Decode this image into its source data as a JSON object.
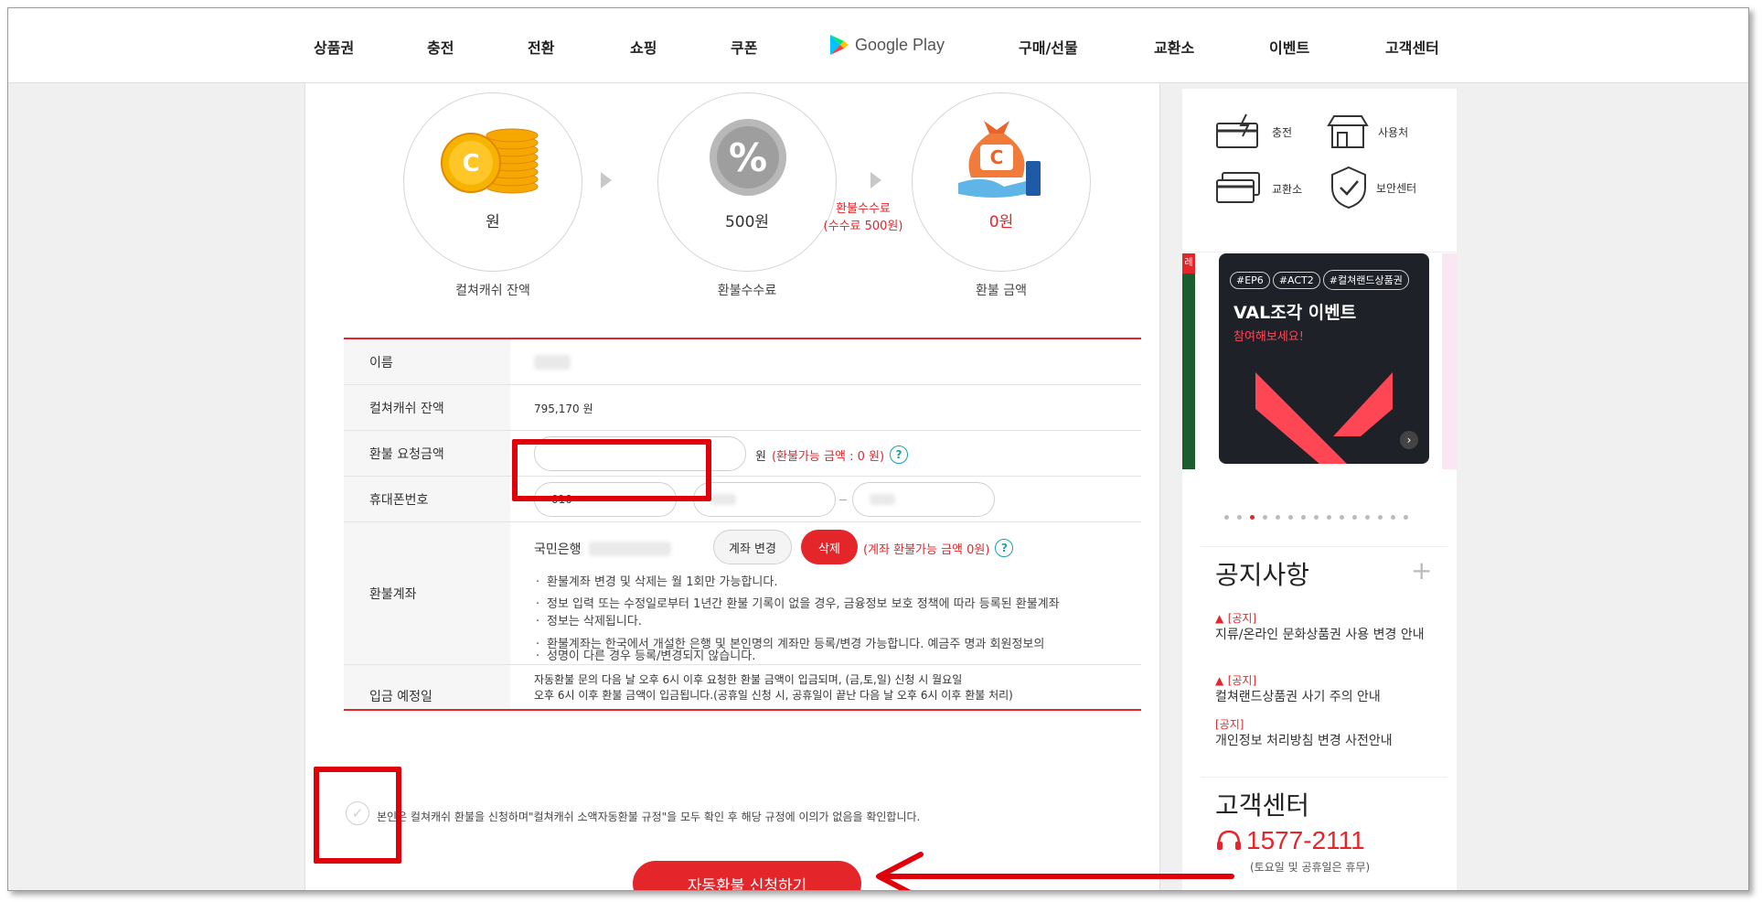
{
  "nav": {
    "items": [
      "상품권",
      "충전",
      "전환",
      "쇼핑",
      "쿠폰"
    ],
    "google_play": "Google Play",
    "items_right": [
      "구매/선물",
      "교환소",
      "이벤트",
      "고객센터"
    ]
  },
  "summary": {
    "balance_amount": "원",
    "balance_caption": "컬쳐캐쉬 잔액",
    "fee_amount": "500원",
    "fee_caption": "환불수수료",
    "fee_note_line1": "환불수수료",
    "fee_note_line2": "(수수료 500원)",
    "refund_amount": "0원",
    "refund_caption": "환불 금액"
  },
  "form": {
    "name_label": "이름",
    "balance_label": "컬쳐캐쉬 잔액",
    "balance_value": "795,170 원",
    "request_label": "환불 요청금액",
    "request_unit": "원",
    "request_note": "(환불가능 금액 : 0 원)",
    "phone_label": "휴대폰번호",
    "phone_first": "010",
    "account_label": "환불계좌",
    "bank_name": "국민은행",
    "change_button": "계좌 변경",
    "delete_button": "삭제",
    "account_note": "(계좌 환불가능 금액 0원)",
    "help_icon": "?",
    "bullets": [
      "환불계좌 변경 및 삭제는 월 1회만 가능합니다.",
      "정보 입력 또는 수정일로부터 1년간 환불 기록이 없을 경우, 금융정보 보호 정책에 따라 등록된 환불계좌",
      "정보는 삭제됩니다.",
      "환불계좌는 한국에서 개설한 은행 및 본인명의 계좌만 등록/변경 가능합니다. 예금주 명과 회원정보의",
      "성명이 다른 경우 등록/변경되지 않습니다."
    ],
    "deposit_label": "입금 예정일",
    "deposit_line1": "자동환불 문의 다음 날 오후 6시 이후 요청한 환불 금액이 입금되며, (금,토,일) 신청 시 월요일",
    "deposit_line2": "오후 6시 이후 환불 금액이 입금됩니다.(공휴일 신청 시, 공휴일이 끝난 다음 날 오후 6시 이후 환불 처리)"
  },
  "agree_text": "본인은 컬쳐캐쉬 환불을 신청하며\"컬쳐캐쉬 소액자동환불 규정\"을 모두 확인 후 해당 규정에 이의가 없음을 확인합니다.",
  "submit_label": "자동환불 신청하기",
  "side": {
    "quick": [
      "충전",
      "사용처",
      "교환소",
      "보안센터"
    ],
    "banner_tags": [
      "#EP6",
      "#ACT2",
      "#컬쳐랜드상품권"
    ],
    "banner_title": "VAL조각 이벤트",
    "banner_sub": "참여해보세요!",
    "notice_title": "공지사항",
    "notice_plus": "+",
    "notices": [
      {
        "tag": "[공지]",
        "text": "지류/온라인 문화상품권 사용 변경 안내"
      },
      {
        "tag": "[공지]",
        "text": "컬쳐랜드상품권 사기 주의 안내"
      },
      {
        "tag": "[공지]",
        "text": "개인정보 처리방침 변경 사전안내"
      }
    ],
    "cs_title": "고객센터",
    "cs_phone": "1577-2111",
    "cs_note": "(토요일 및 공휴일은 휴무)",
    "side_label": "레"
  },
  "colors": {
    "accent": "#e4262b",
    "help": "#18a3a8",
    "annotation": "#e0000a"
  }
}
